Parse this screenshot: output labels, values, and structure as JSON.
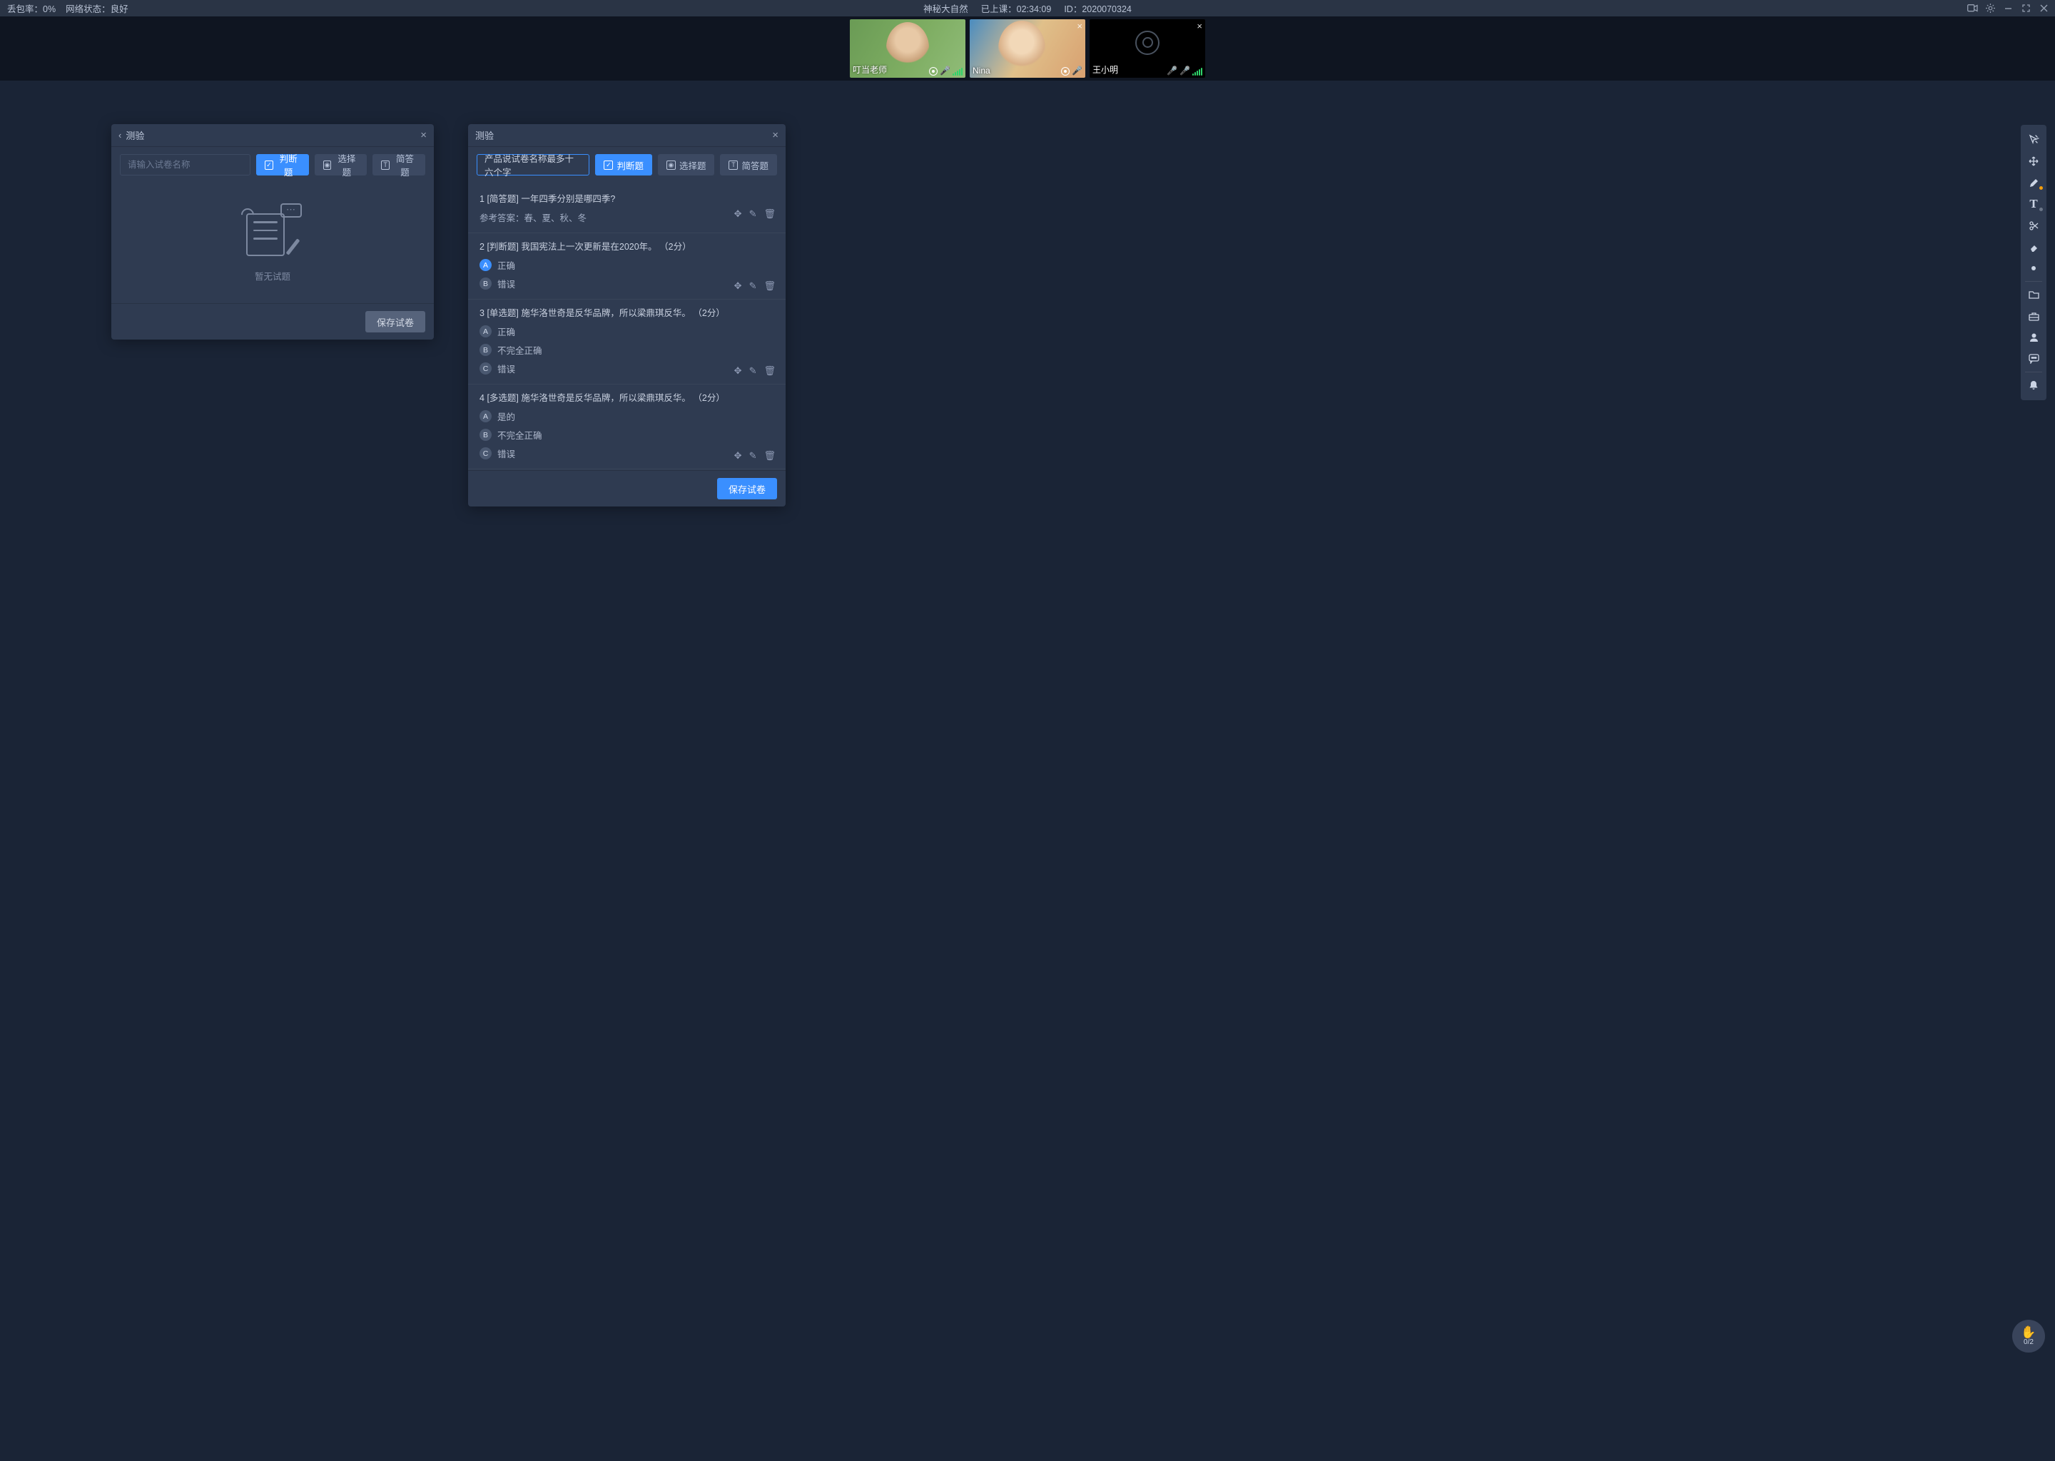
{
  "topbar": {
    "packet_loss_label": "丢包率：",
    "packet_loss_value": "0%",
    "network_label": "网络状态：",
    "network_value": "良好",
    "course_title": "神秘大自然",
    "elapsed_label": "已上课：",
    "elapsed_value": "02:34:09",
    "id_label": "ID：",
    "id_value": "2020070324"
  },
  "participants": [
    {
      "name": "叮当老师",
      "camera": "on",
      "role": "teacher"
    },
    {
      "name": "Nina",
      "camera": "on",
      "role": "student"
    },
    {
      "name": "王小明",
      "camera": "off",
      "role": "student"
    }
  ],
  "quiz_panel_left": {
    "title": "测验",
    "name_placeholder": "请输入试卷名称",
    "btn_judge": "判断题",
    "btn_choice": "选择题",
    "btn_short": "简答题",
    "empty_text": "暂无试题",
    "save_label": "保存试卷"
  },
  "quiz_panel_right": {
    "title": "测验",
    "quiz_name": "产品说试卷名称最多十六个字",
    "btn_judge": "判断题",
    "btn_choice": "选择题",
    "btn_short": "简答题",
    "save_label": "保存试卷",
    "questions": [
      {
        "number": "1",
        "type_label": "[简答题]",
        "text": "一年四季分别是哪四季?",
        "answer_label": "参考答案：",
        "answer": "春、夏、秋、冬"
      },
      {
        "number": "2",
        "type_label": "[判断题]",
        "text": "我国宪法上一次更新是在2020年。",
        "score": "（2分）",
        "options": [
          {
            "letter": "A",
            "text": "正确",
            "selected": true
          },
          {
            "letter": "B",
            "text": "错误",
            "selected": false
          }
        ]
      },
      {
        "number": "3",
        "type_label": "[单选题]",
        "text": "施华洛世奇是反华品牌，所以梁鼎琪反华。",
        "score": "（2分）",
        "options": [
          {
            "letter": "A",
            "text": "正确",
            "selected": false
          },
          {
            "letter": "B",
            "text": "不完全正确",
            "selected": false
          },
          {
            "letter": "C",
            "text": "错误",
            "selected": false
          }
        ]
      },
      {
        "number": "4",
        "type_label": "[多选题]",
        "text": "施华洛世奇是反华品牌，所以梁鼎琪反华。",
        "score": "（2分）",
        "options": [
          {
            "letter": "A",
            "text": "是的",
            "selected": false
          },
          {
            "letter": "B",
            "text": "不完全正确",
            "selected": false
          },
          {
            "letter": "C",
            "text": "错误",
            "selected": false
          }
        ]
      }
    ]
  },
  "raise_hand": {
    "count": "0/2"
  },
  "tool_names": {
    "cursor": "cursor",
    "move": "move",
    "pen": "pen",
    "text": "text",
    "scissors": "scissors",
    "eraser": "eraser",
    "laser": "laser",
    "folder": "folder",
    "toolbox": "toolbox",
    "users": "users",
    "chat": "chat",
    "bell": "bell"
  }
}
